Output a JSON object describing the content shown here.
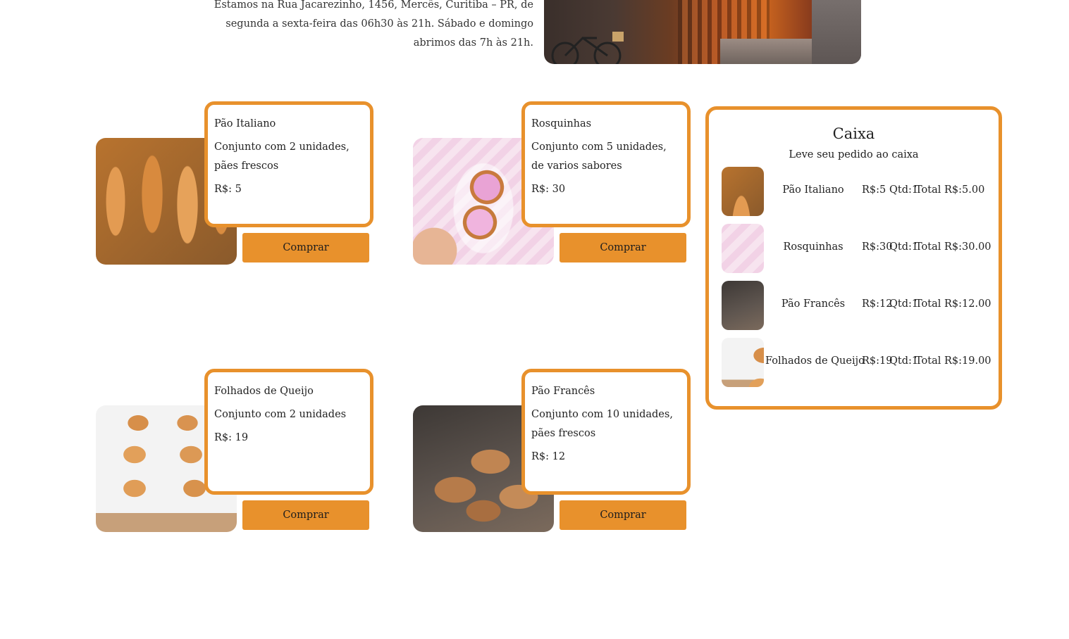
{
  "info": {
    "address_text": "Estamos na Rua Jacarezinho, 1456, Mercês, Curitiba – PR, de segunda a sexta-feira das 06h30 às 21h. Sábado e domingo abrimos das 7h às 21h."
  },
  "colors": {
    "accent": "#e8912c",
    "text": "#222222",
    "background": "#ffffff"
  },
  "products": [
    {
      "name": "Pão Italiano",
      "description": "Conjunto com 2 unidades, pães frescos",
      "price": "R$: 5",
      "button_label": "Comprar",
      "image": "pao-italiano-photo"
    },
    {
      "name": "Rosquinhas",
      "description": "Conjunto com 5 unidades, de varios sabores",
      "price": "R$: 30",
      "button_label": "Comprar",
      "image": "rosquinhas-photo"
    },
    {
      "name": "Folhados de Queijo",
      "description": "Conjunto com 2 unidades",
      "price": "R$: 19",
      "button_label": "Comprar",
      "image": "folhados-photo"
    },
    {
      "name": "Pão Francês",
      "description": "Conjunto com 10 unidades, pães frescos",
      "price": "R$: 12",
      "button_label": "Comprar",
      "image": "pao-frances-photo"
    }
  ],
  "caixa": {
    "title": "Caixa",
    "subtitle": "Leve seu pedido ao caixa",
    "items": [
      {
        "name": "Pão Italiano",
        "price": "R$:5",
        "qtd": "Qtd:1",
        "total": "Total R$:5.00"
      },
      {
        "name": "Rosquinhas",
        "price": "R$:30",
        "qtd": "Qtd:1",
        "total": "Total R$:30.00"
      },
      {
        "name": "Pão Francês",
        "price": "R$:12",
        "qtd": "Qtd:1",
        "total": "Total R$:12.00"
      },
      {
        "name": "Folhados de Queijo",
        "price": "R$:19",
        "qtd": "Qtd:1",
        "total": "Total R$:19.00"
      }
    ]
  }
}
